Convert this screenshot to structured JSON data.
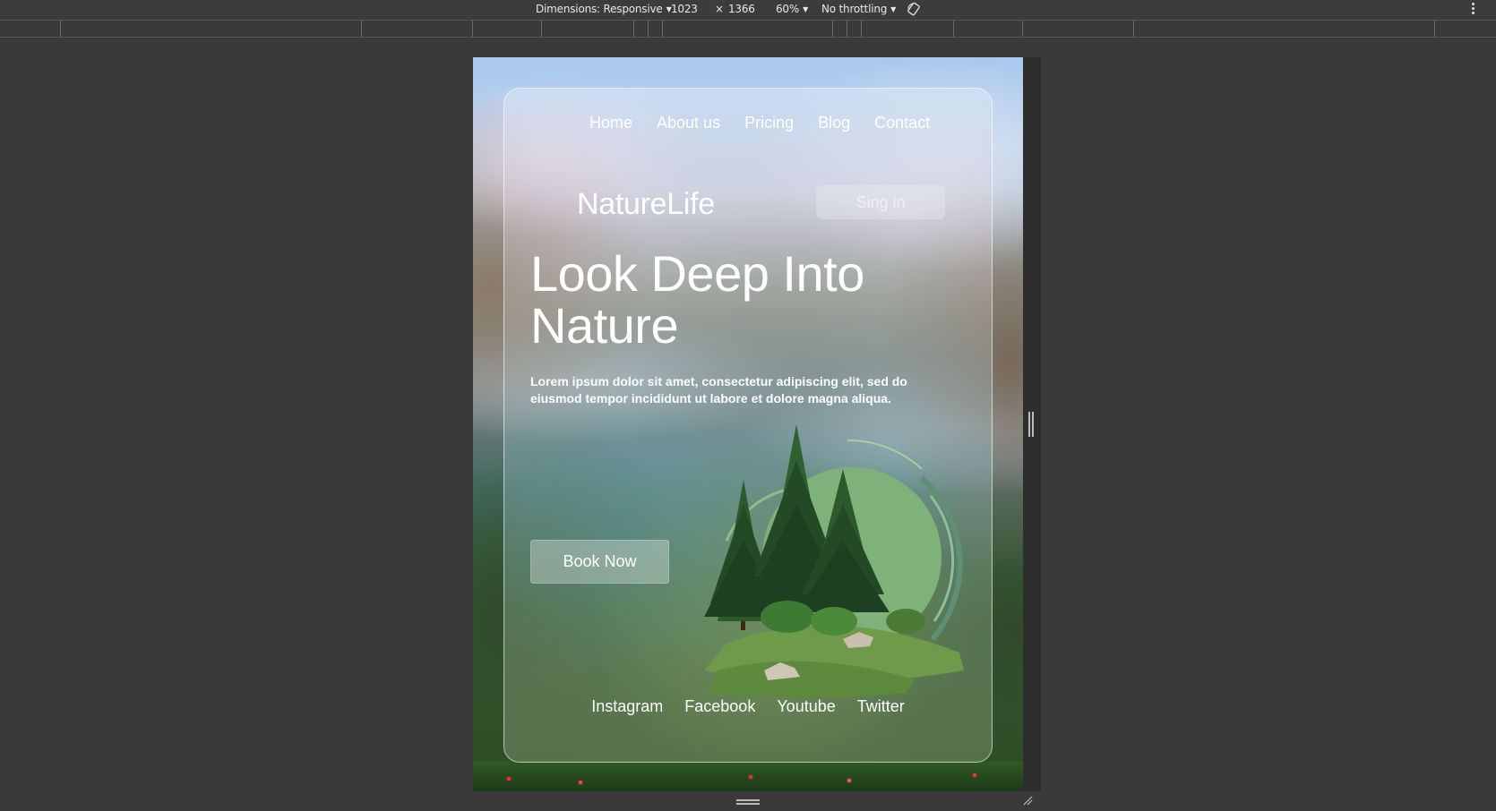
{
  "devtools": {
    "dimensions_label": "Dimensions: Responsive",
    "width": "1023",
    "times": "×",
    "height": "1366",
    "zoom": "60%",
    "throttling": "No throttling"
  },
  "nav": {
    "items": [
      "Home",
      "About us",
      "Pricing",
      "Blog",
      "Contact"
    ]
  },
  "brand": "NatureLife",
  "signin_label": "Sing in",
  "hero": {
    "headline_line1": "Look Deep Into",
    "headline_line2": "Nature",
    "body": "Lorem ipsum dolor sit amet, consectetur adipiscing elit, sed do eiusmod tempor incididunt ut labore et dolore magna aliqua."
  },
  "book_label": "Book Now",
  "social": [
    "Instagram",
    "Facebook",
    "Youtube",
    "Twitter"
  ],
  "colors": {
    "devtools_bg": "#3a3a3a",
    "circle_green": "#7fb27a",
    "tree_dark": "#1f3f22"
  }
}
